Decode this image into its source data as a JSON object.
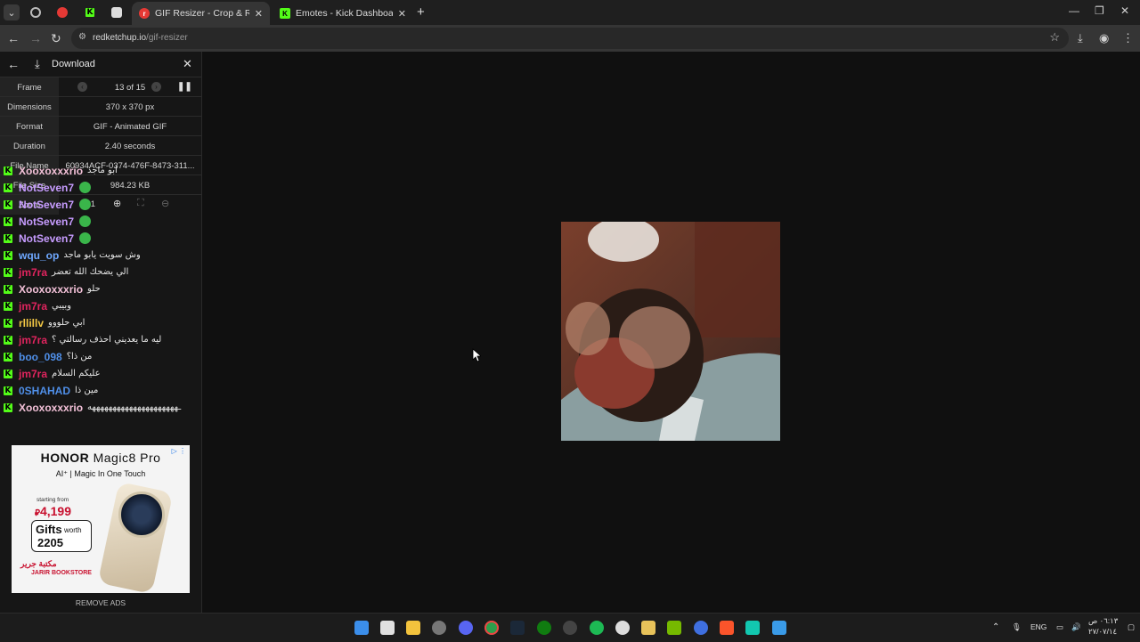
{
  "browser": {
    "tabs": [
      {
        "title": "GIF Resizer - Crop & Resize Animated GIFs",
        "active": true,
        "close": "✕"
      },
      {
        "title": "Emotes - Kick Dashboard",
        "active": false,
        "close": "✕"
      }
    ],
    "new_tab": "+",
    "url_host": "redketchup.io",
    "url_path": "/gif-resizer"
  },
  "panel": {
    "back_icon": "arrow-left-icon",
    "download_label": "Download",
    "close_icon": "close-icon",
    "info": {
      "frame_key": "Frame",
      "frame_val": "13 of 15",
      "dimensions_key": "Dimensions",
      "dimensions_val": "370 x 370 px",
      "format_key": "Format",
      "format_val": "GIF - Animated GIF",
      "duration_key": "Duration",
      "duration_val": "2.40 seconds",
      "filename_key": "File Name",
      "filename_val": "60934ACF-0374-476F-8473-311...",
      "filesize_key": "File Size",
      "filesize_val": "984.23 KB",
      "zoom_key": "Zoom",
      "zoom_val": "x1"
    }
  },
  "chat": [
    {
      "user": "Xooxoxxxrio",
      "text": "ابو ماجد",
      "color": "#f3c1d8",
      "badge": false
    },
    {
      "user": "NotSeven7",
      "text": "",
      "color": "#c79cff",
      "badge": true
    },
    {
      "user": "NotSeven7",
      "text": "",
      "color": "#c79cff",
      "badge": true
    },
    {
      "user": "NotSeven7",
      "text": "",
      "color": "#c79cff",
      "badge": true
    },
    {
      "user": "NotSeven7",
      "text": "",
      "color": "#c79cff",
      "badge": true
    },
    {
      "user": "wqu_op",
      "text": "وش سويت يابو ماجد",
      "color": "#6fa8ff",
      "badge": false
    },
    {
      "user": "jm7ra",
      "text": "الي يضحك الله تعضر",
      "color": "#e0245e",
      "badge": false
    },
    {
      "user": "Xooxoxxxrio",
      "text": "حلو",
      "color": "#f3c1d8",
      "badge": false
    },
    {
      "user": "jm7ra",
      "text": "وبيبي",
      "color": "#e0245e",
      "badge": false
    },
    {
      "user": "rllillv",
      "text": "ابي حلووو",
      "color": "#f2c744",
      "badge": false
    },
    {
      "user": "jm7ra",
      "text": "ليه ما يعديني احذف رسالتي ؟",
      "color": "#e0245e",
      "badge": false
    },
    {
      "user": "boo_098",
      "text": "من ذا؟",
      "color": "#4f8fe8",
      "badge": false
    },
    {
      "user": "jm7ra",
      "text": "عليكم السلام",
      "color": "#e0245e",
      "badge": false
    },
    {
      "user": "0SHAHAD",
      "text": "مين ذا",
      "color": "#4f8fe8",
      "badge": false
    },
    {
      "user": "Xooxoxxxrio",
      "text": "ـهههههههههههههههههههههه",
      "color": "#f3c1d8",
      "badge": false
    }
  ],
  "ad": {
    "brand": "HONOR",
    "model": "Magic8 Pro",
    "tagline": "AI⁺ | Magic In One Touch",
    "starting": "starting from",
    "price": "4,199",
    "gifts": "Gifts",
    "worth": "worth",
    "gift_value": "2205",
    "store": "JARIR BOOKSTORE",
    "store_ar": "مكتبة جرير",
    "remove_ads": "REMOVE ADS"
  },
  "taskbar": {
    "lang": "ENG",
    "time": "٠٦:١٣ ص",
    "date": "٢٧/٠٧/١٤"
  },
  "colors": {
    "accent_kick": "#53fc18",
    "bg": "#101010",
    "panel": "#161616"
  }
}
